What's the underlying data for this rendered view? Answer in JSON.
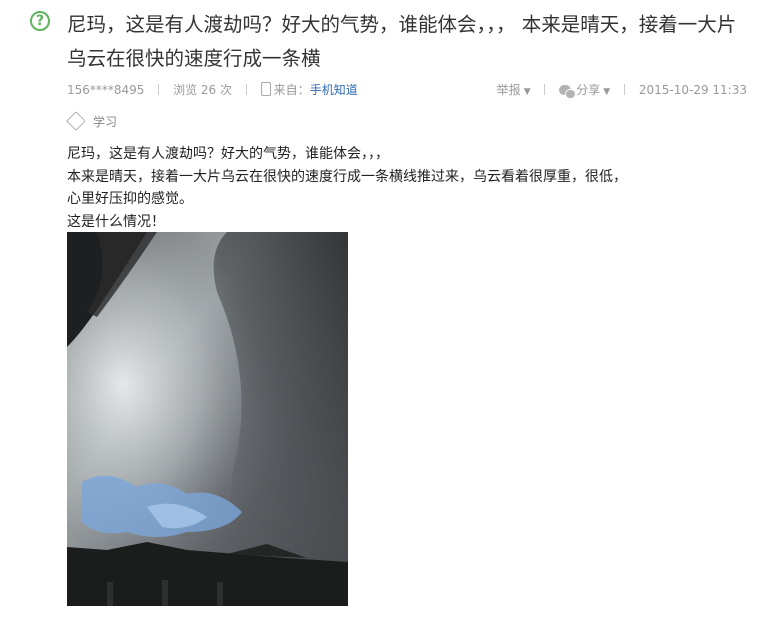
{
  "question": {
    "title": "尼玛，这是有人渡劫吗？好大的气势，谁能体会，，，  本来是晴天，接着一大片乌云在很快的速度行成一条横"
  },
  "meta": {
    "user": "156****8495",
    "views": "浏览 26 次",
    "source_prefix": "来自：",
    "source_link": "手机知道",
    "report": "举报",
    "share": "分享",
    "datetime": "2015-10-29 11:33"
  },
  "tag": {
    "label": "学习"
  },
  "body": {
    "lines": [
      "尼玛，这是有人渡劫吗？好大的气势，谁能体会，，，",
      "本来是晴天，接着一大片乌云在很快的速度行成一条横线推过来，乌云看着很厚重，很低，",
      "心里好压抑的感觉。",
      "这是什么情况！"
    ]
  },
  "colors": {
    "accent_green": "#5fb35f",
    "link_blue": "#2e6ab1",
    "meta_gray": "#999999"
  },
  "icons": {
    "question": "question-circle-icon",
    "phone": "phone-icon",
    "share": "chat-bubbles-icon",
    "tag": "tag-icon"
  }
}
